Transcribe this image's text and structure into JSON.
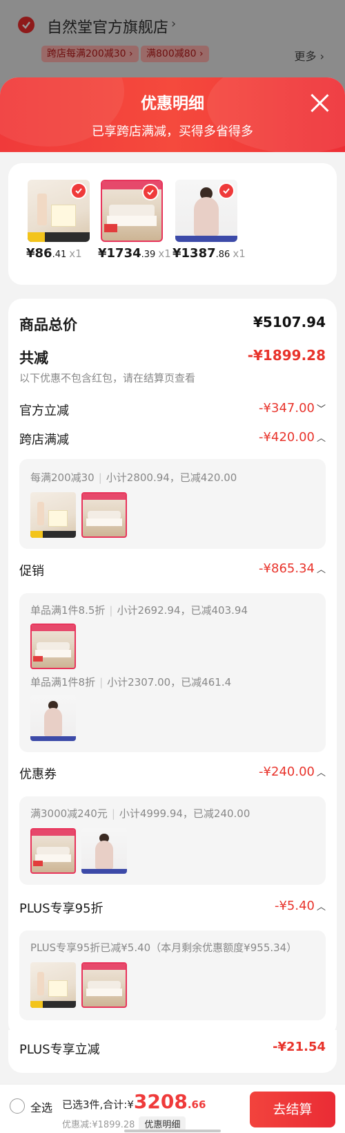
{
  "store": {
    "name": "自然堂官方旗舰店",
    "tags": [
      "跨店每满200减30 ›",
      "满800减80 ›"
    ],
    "more": "更多 ›"
  },
  "sheet": {
    "title": "优惠明细",
    "subtitle": "已享跨店满减，买得多省得多"
  },
  "products": [
    {
      "price_int": "¥86",
      "price_dec": ".41",
      "qty": "x1",
      "art": "cream"
    },
    {
      "price_int": "¥1734",
      "price_dec": ".39",
      "qty": "x1",
      "art": "bed"
    },
    {
      "price_int": "¥1387",
      "price_dec": ".86",
      "qty": "x1",
      "art": "woman"
    }
  ],
  "summary": {
    "total_label": "商品总价",
    "total_value": "¥5107.94",
    "reduce_label": "共减",
    "reduce_value": "-¥1899.28",
    "note": "以下优惠不包含红包，请在结算页查看"
  },
  "discounts": {
    "official": {
      "label": "官方立减",
      "value": "-¥347.00",
      "caret": "﹀"
    },
    "crossstore": {
      "label": "跨店满减",
      "value": "-¥420.00",
      "caret": "︿",
      "line_a": "每满200减30",
      "line_b": "小计2800.94，已减420.00"
    },
    "promo": {
      "label": "促销",
      "value": "-¥865.34",
      "caret": "︿",
      "line1_a": "单品满1件8.5折",
      "line1_b": "小计2692.94，已减403.94",
      "line2_a": "单品满1件8折",
      "line2_b": "小计2307.00，已减461.4"
    },
    "coupon": {
      "label": "优惠券",
      "value": "-¥240.00",
      "caret": "︿",
      "line_a": "满3000减240元",
      "line_b": "小计4999.94，已减240.00"
    },
    "plus95": {
      "label": "PLUS专享95折",
      "value": "-¥5.40",
      "caret": "︿",
      "line": "PLUS专享95折已减¥5.40（本月剩余优惠额度¥955.34）"
    },
    "plusdirect": {
      "label": "PLUS专享立减",
      "value": "-¥21.54"
    }
  },
  "bottom": {
    "select_all": "全选",
    "selected_prefix": "已选3件,合计:¥",
    "total_int": "3208",
    "total_dec": ".66",
    "saved": "优惠减:¥1899.28",
    "detail_chip": "优惠明细",
    "checkout": "去结算"
  }
}
